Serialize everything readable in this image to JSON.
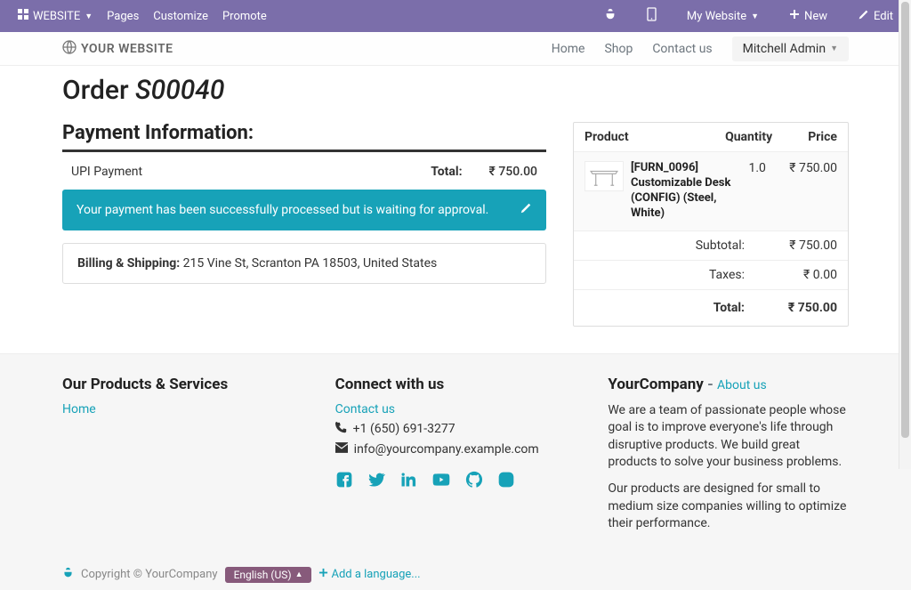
{
  "topbar": {
    "website": "WEBSITE",
    "pages": "Pages",
    "customize": "Customize",
    "promote": "Promote",
    "my_website": "My Website",
    "new": "New",
    "edit": "Edit"
  },
  "secondbar": {
    "brand": "YOUR WEBSITE",
    "home": "Home",
    "shop": "Shop",
    "contact": "Contact us",
    "user": "Mitchell Admin"
  },
  "order": {
    "title_prefix": "Order ",
    "number": "S00040"
  },
  "payment": {
    "heading": "Payment Information:",
    "method": "UPI Payment",
    "total_label": "Total:",
    "total_value": "₹ 750.00",
    "alert": "Your payment has been successfully processed but is waiting for approval.",
    "billing_label": "Billing & Shipping:",
    "billing_value": " 215 Vine St, Scranton PA 18503, United States"
  },
  "summary": {
    "head_product": "Product",
    "head_qty": "Quantity",
    "head_price": "Price",
    "item": {
      "name": "[FURN_0096] Customizable Desk (CONFIG) (Steel, White)",
      "qty": "1.0",
      "price": "₹ 750.00"
    },
    "subtotal_label": "Subtotal:",
    "subtotal_value": "₹ 750.00",
    "taxes_label": "Taxes:",
    "taxes_value": "₹ 0.00",
    "total_label": "Total:",
    "total_value": "₹ 750.00"
  },
  "footer": {
    "products_h": "Our Products & Services",
    "home": "Home",
    "connect_h": "Connect with us",
    "contact": "Contact us",
    "phone": "+1 (650) 691-3277",
    "email": "info@yourcompany.example.com",
    "about_company": "YourCompany",
    "about_dash": " - ",
    "about_link": "About us",
    "p1": "We are a team of passionate people whose goal is to improve everyone's life through disruptive products. We build great products to solve your business problems.",
    "p2": "Our products are designed for small to medium size companies willing to optimize their performance.",
    "copyright": "Copyright © YourCompany",
    "lang": "English (US)",
    "addlang": "Add a language..."
  }
}
